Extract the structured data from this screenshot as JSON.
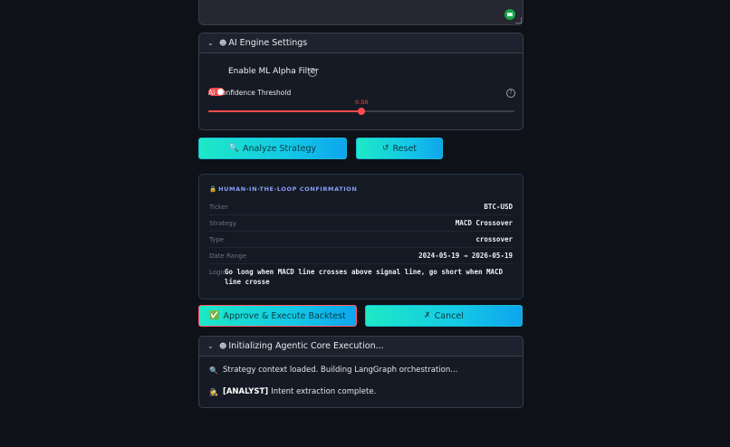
{
  "ai_engine": {
    "header": "AI Engine Settings",
    "header_icon": "robot-icon",
    "toggle_label": "Enable ML Alpha Filter",
    "toggle_on": true,
    "confidence_label": "AI Confidence Threshold",
    "confidence_value": "0.50",
    "confidence_min": 0,
    "confidence_max": 1
  },
  "actions": {
    "analyze_label": "Analyze Strategy",
    "analyze_icon": "🔍",
    "reset_label": "Reset",
    "reset_icon": "↺"
  },
  "confirmation": {
    "title": "HUMAN-IN-THE-LOOP CONFIRMATION",
    "title_icon": "lock-icon",
    "rows": [
      {
        "label": "Ticker",
        "value": "BTC-USD"
      },
      {
        "label": "Strategy",
        "value": "MACD Crossover"
      },
      {
        "label": "Type",
        "value": "crossover"
      },
      {
        "label": "Date Range",
        "value": "2024-05-19 → 2026-05-19"
      }
    ],
    "logic_label": "Logic",
    "logic_value": "Go long when MACD line crosses above signal line, go short when MACD line crosse"
  },
  "decision": {
    "approve_label": "Approve & Execute Backtest",
    "approve_icon": "✅",
    "cancel_label": "Cancel",
    "cancel_icon": "✗"
  },
  "execution": {
    "header": "Initializing Agentic Core Execution...",
    "header_icon": "robot-icon",
    "lines": [
      {
        "icon": "🔍",
        "bold": "",
        "text": "Strategy context loaded. Building LangGraph orchestration..."
      },
      {
        "icon": "🕵",
        "bold": "[ANALYST]",
        "text": "Intent extraction complete."
      }
    ]
  },
  "colors": {
    "background": "#0e1117",
    "accent_red": "#ff4b4b",
    "button_gradient_start": "#1de9c6",
    "button_gradient_end": "#0ea5ee"
  }
}
